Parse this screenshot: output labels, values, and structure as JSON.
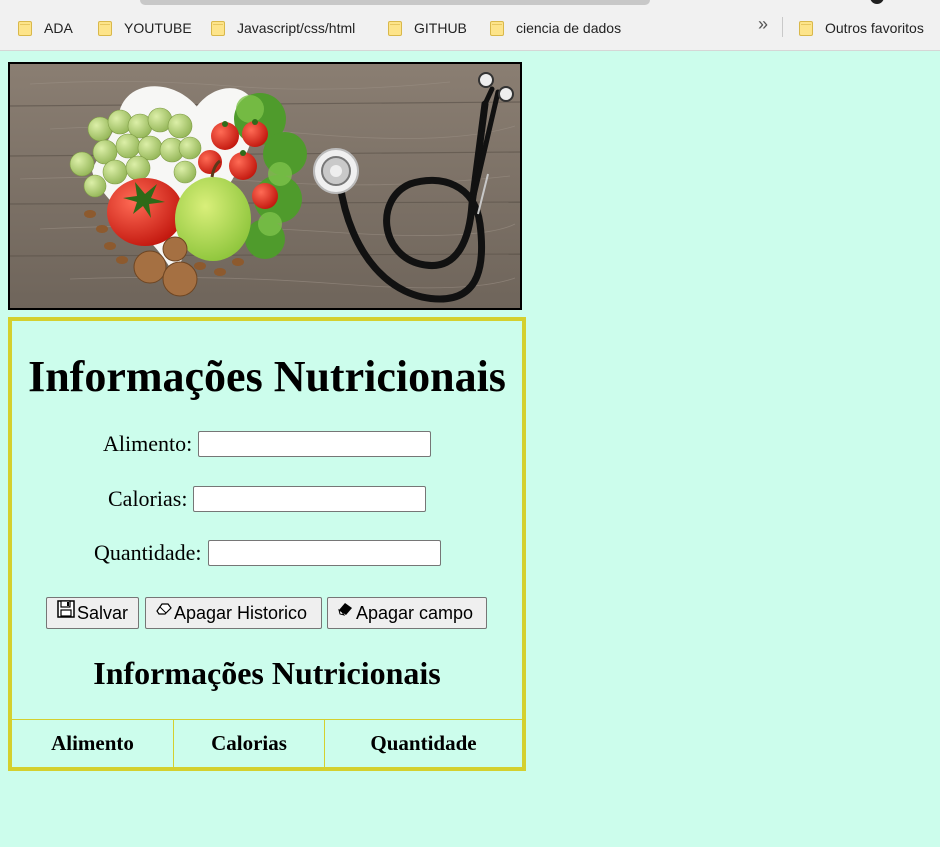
{
  "bookmarks": {
    "items": [
      {
        "label": "ADA",
        "icon": "folder-icon"
      },
      {
        "label": "YOUTUBE",
        "icon": "folder-icon"
      },
      {
        "label": "Javascript/css/html",
        "icon": "folder-icon"
      },
      {
        "label": "GITHUB",
        "icon": "folder-icon"
      },
      {
        "label": "ciencia de dados",
        "icon": "folder-icon"
      }
    ],
    "overflow_label": "»",
    "other_favorites": "Outros favoritos"
  },
  "main": {
    "title": "Informações Nutricionais",
    "form": {
      "food_label": "Alimento:",
      "food_value": "",
      "calories_label": "Calorias:",
      "calories_value": "",
      "quantity_label": "Quantidade:",
      "quantity_value": ""
    },
    "buttons": {
      "save": "Salvar",
      "clear_history": "Apagar Historico",
      "clear_field": "Apagar campo"
    },
    "table_title": "Informações Nutricionais",
    "table_headers": [
      "Alimento",
      "Calorias",
      "Quantidade"
    ]
  },
  "colors": {
    "page_background": "#ccfdec",
    "panel_border": "#d4d02e"
  }
}
